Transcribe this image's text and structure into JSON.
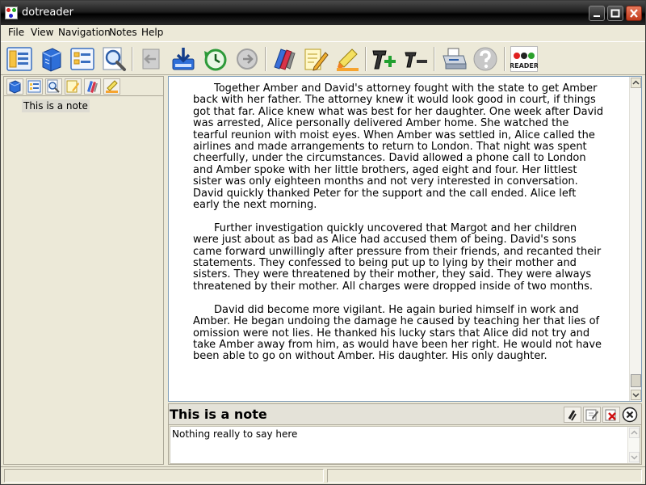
{
  "window": {
    "title": "dotreader"
  },
  "menu": {
    "items": [
      "File",
      "View",
      "Navigation",
      "Notes",
      "Help"
    ]
  },
  "toolbar": {
    "buttons": [
      "library-icon",
      "book-icon",
      "contents-icon",
      "search-icon",
      "back-icon",
      "download-icon",
      "history-icon",
      "forward-icon",
      "bookmark-icon",
      "annotate-icon",
      "highlight-icon",
      "font-increase-icon",
      "font-decrease-icon",
      "print-icon",
      "help-icon",
      "dotreader-logo"
    ],
    "logo_text": "DOT READER"
  },
  "left_panel": {
    "tabs": [
      "book-icon",
      "contents-icon",
      "search-icon",
      "notes-icon",
      "bookmark-icon",
      "highlight-icon"
    ],
    "notes": [
      {
        "label": "This is a note"
      }
    ]
  },
  "reader": {
    "paragraphs": [
      "Together Amber and David's attorney fought with the state to get Amber back with her father. The attorney knew it would look good in court, if things got that far. Alice knew what was best for her daughter. One week after David was arrested, Alice personally delivered Amber home. She watched the tearful reunion with moist eyes. When Amber was settled in, Alice called the airlines and made arrangements to return to London. That night was spent cheerfully, under the circumstances. David allowed a phone call to London and Amber spoke with her little brothers, aged eight and four. Her littlest sister was only eighteen months and not very interested in conversation. David quickly thanked Peter for the support and the call ended. Alice left early the next morning.",
      "Further investigation quickly uncovered that Margot and her children were just about as bad as Alice had accused them of being. David's sons came forward unwillingly after pressure from their friends, and recanted their statements. They confessed to being put up to lying by their mother and sisters. They were threatened by their mother, they said. They were always threatened by their mother. All charges were dropped inside of two months.",
      "David did become more vigilant. He again buried himself in work and Amber. He began undoing the damage he caused by teaching her that lies of omission were not lies. He thanked his lucky stars that Alice did not try and take Amber away from him, as would have been her right. He would not have been able to go on without Amber. His daughter. His only daughter."
    ]
  },
  "note": {
    "title": "This is a note",
    "body": "Nothing really to say here"
  },
  "colors": {
    "titlebar": "#1e1e1e",
    "chrome": "#ece9d8",
    "reader_border": "#7f9db9",
    "close_button": "#c0391a"
  }
}
